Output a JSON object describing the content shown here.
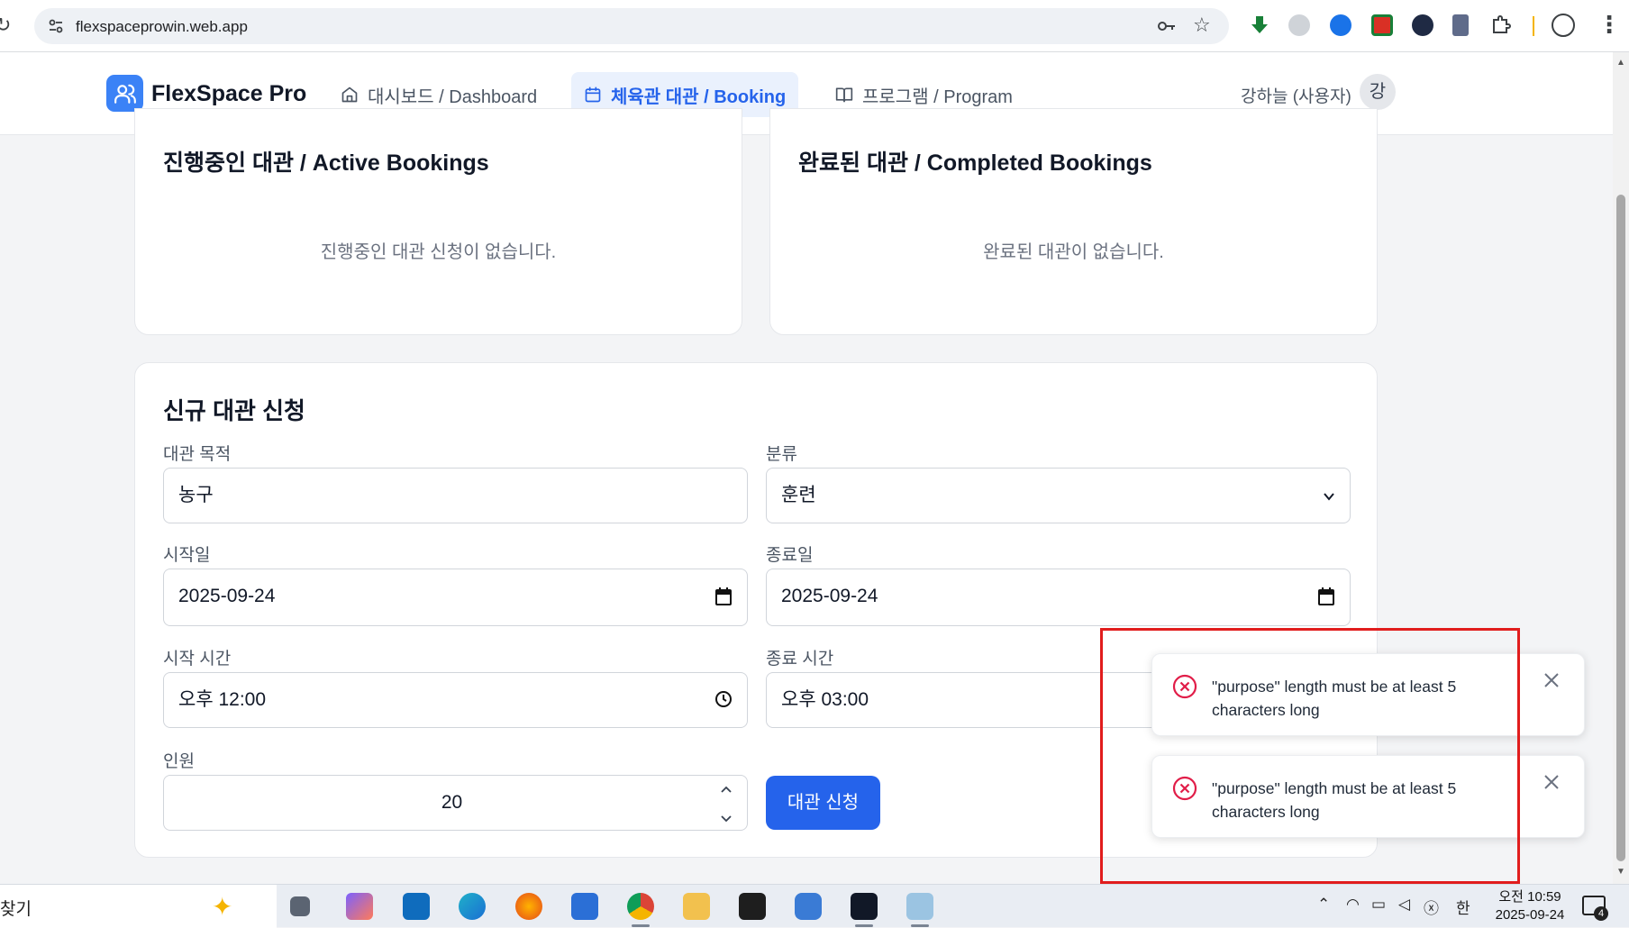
{
  "browser": {
    "url": "flexspaceprowin.web.app"
  },
  "header": {
    "brand": "FlexSpace Pro",
    "nav": [
      {
        "label": "대시보드 / Dashboard",
        "icon": "home-icon",
        "active": false
      },
      {
        "label": "체육관 대관 / Booking",
        "icon": "calendar-icon",
        "active": true
      },
      {
        "label": "프로그램 / Program",
        "icon": "book-icon",
        "active": false
      }
    ],
    "user_name": "강하늘 (사용자)",
    "avatar_initial": "강"
  },
  "active_bookings": {
    "title": "진행중인 대관 / Active Bookings",
    "empty_text": "진행중인 대관 신청이 없습니다."
  },
  "completed_bookings": {
    "title": "완료된 대관 / Completed Bookings",
    "empty_text": "완료된 대관이 없습니다."
  },
  "form": {
    "title": "신규 대관 신청",
    "purpose": {
      "label": "대관 목적",
      "value": "농구"
    },
    "category": {
      "label": "분류",
      "value": "훈련"
    },
    "start_date": {
      "label": "시작일",
      "value": "2025-09-24"
    },
    "end_date": {
      "label": "종료일",
      "value": "2025-09-24"
    },
    "start_time": {
      "label": "시작 시간",
      "value": "오후 12:00"
    },
    "end_time": {
      "label": "종료 시간",
      "value": "오후 03:00"
    },
    "headcount": {
      "label": "인원",
      "value": "20"
    },
    "submit_label": "대관 신청"
  },
  "toasts": [
    {
      "message": "\"purpose\" length must be at least 5 characters long",
      "type": "error"
    },
    {
      "message": "\"purpose\" length must be at least 5 characters long",
      "type": "error"
    }
  ],
  "taskbar": {
    "search_label": "찾기",
    "ime": "한",
    "clock_period_time": "오전 10:59",
    "clock_date": "2025-09-24",
    "notification_count": "4"
  },
  "colors": {
    "primary": "#2563eb",
    "logo": "#3b82f6",
    "error": "#e11d48",
    "highlight_box": "#e11d1d"
  }
}
